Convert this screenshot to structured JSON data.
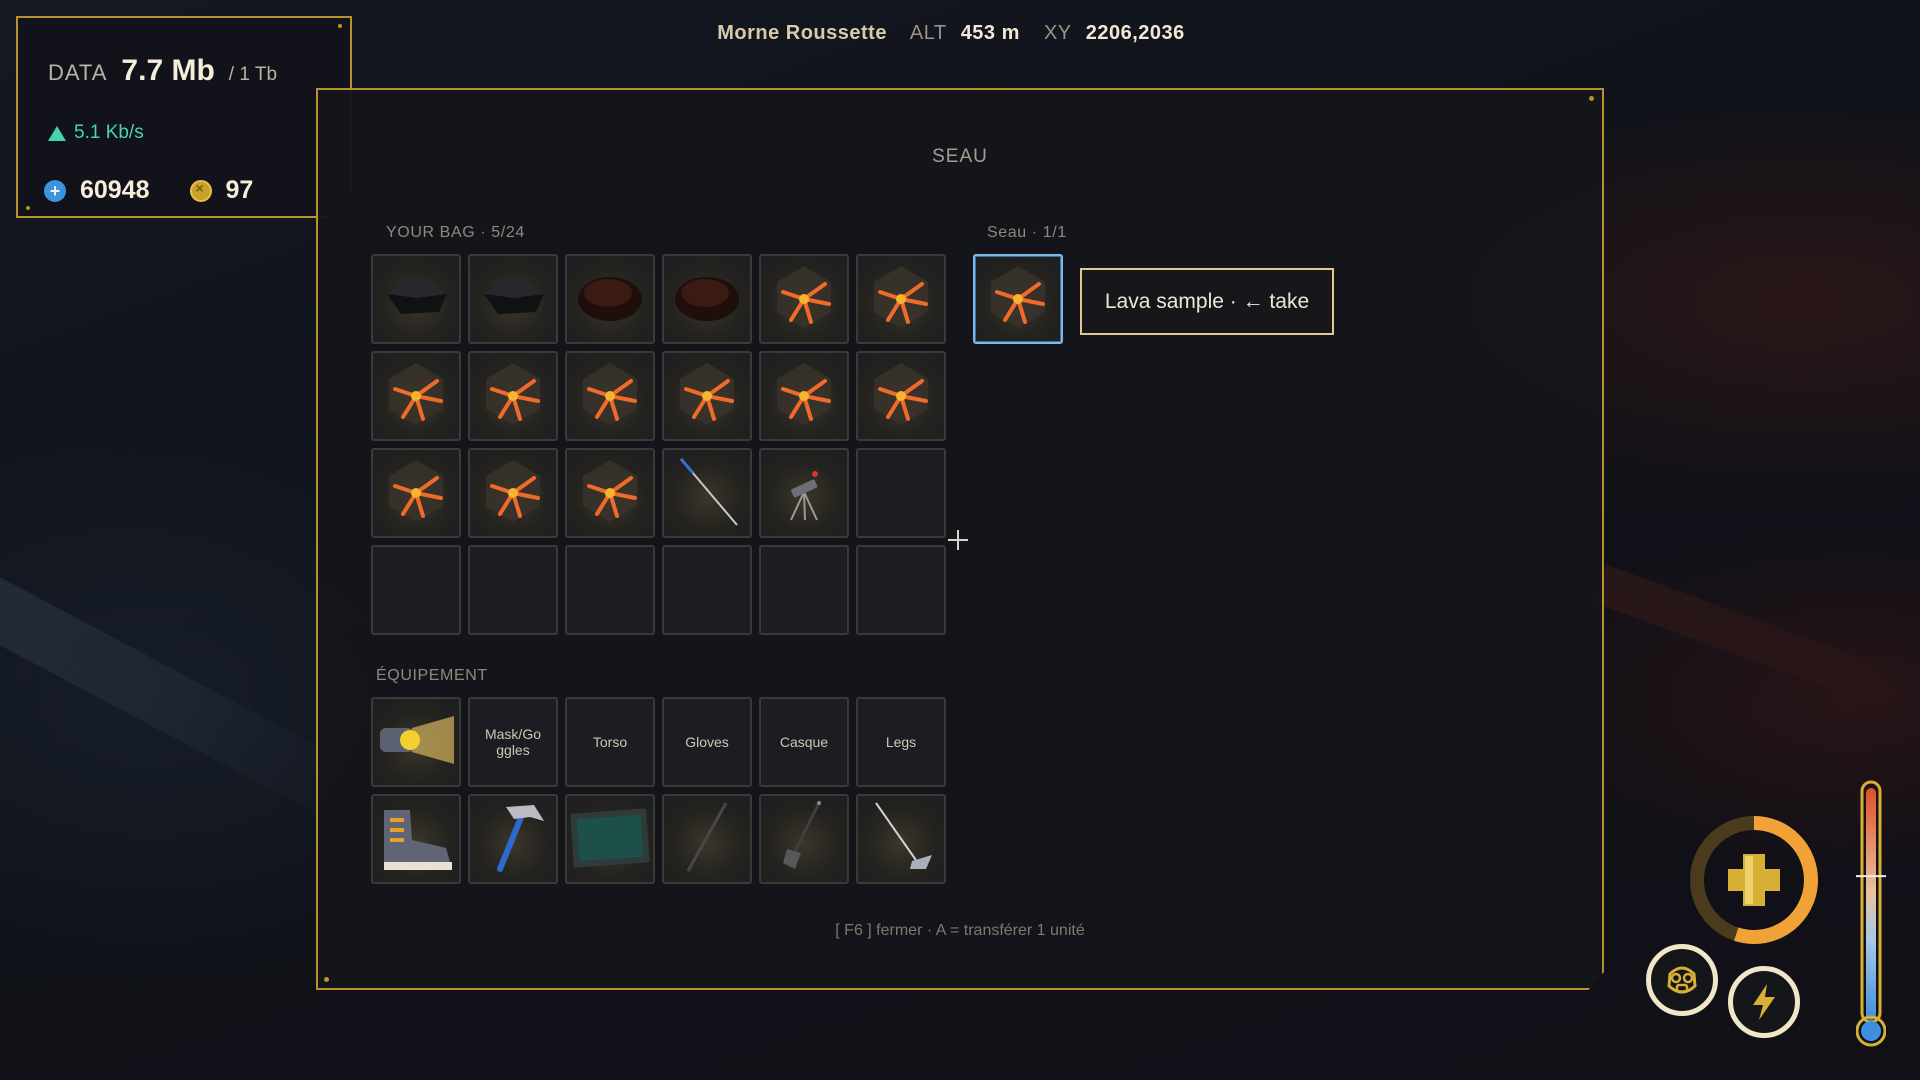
{
  "hud": {
    "location": "Morne Roussette",
    "alt_label": "ALT",
    "alt_value": "453 m",
    "xy_label": "XY",
    "xy_value": "2206,2036"
  },
  "data_panel": {
    "label": "DATA",
    "value": "7.7 Mb",
    "capacity": "/ 1 Tb",
    "rate": "5.1 Kb/s",
    "credits": "60948",
    "coins": "97"
  },
  "container": {
    "title": "SEAU",
    "bag_label": "YOUR BAG  ·  5/24",
    "container_label": "Seau  ·  1/1",
    "equipment_label": "ÉQUIPEMENT",
    "hint": "Lava sample · ← take",
    "footer": "[ F6 ] fermer · A = transférer 1 unité"
  },
  "bag_slots": [
    {
      "item": "dark-rock-icon"
    },
    {
      "item": "dark-rock-icon"
    },
    {
      "item": "red-rock-icon"
    },
    {
      "item": "red-rock-icon"
    },
    {
      "item": "lava-sample-icon"
    },
    {
      "item": "lava-sample-icon"
    },
    {
      "item": "lava-sample-icon"
    },
    {
      "item": "lava-sample-icon"
    },
    {
      "item": "lava-sample-icon"
    },
    {
      "item": "lava-sample-icon"
    },
    {
      "item": "lava-sample-icon"
    },
    {
      "item": "lava-sample-icon"
    },
    {
      "item": "lava-sample-icon"
    },
    {
      "item": "lava-sample-icon"
    },
    {
      "item": "lava-sample-icon"
    },
    {
      "item": "probe-rod-icon"
    },
    {
      "item": "tripod-sensor-icon"
    },
    {
      "item": ""
    },
    {
      "item": ""
    },
    {
      "item": ""
    },
    {
      "item": ""
    },
    {
      "item": ""
    },
    {
      "item": ""
    },
    {
      "item": ""
    }
  ],
  "equipment_slots": [
    {
      "item": "headlamp-icon",
      "label": ""
    },
    {
      "item": "",
      "label": "Mask/Go ggles"
    },
    {
      "item": "",
      "label": "Torso"
    },
    {
      "item": "",
      "label": "Gloves"
    },
    {
      "item": "",
      "label": "Casque"
    },
    {
      "item": "",
      "label": "Legs"
    },
    {
      "item": "boot-icon",
      "label": ""
    },
    {
      "item": "hammer-icon",
      "label": ""
    },
    {
      "item": "tablet-icon",
      "label": ""
    },
    {
      "item": "staff-icon",
      "label": ""
    },
    {
      "item": "shovel-icon",
      "label": ""
    },
    {
      "item": "hoe-icon",
      "label": ""
    }
  ],
  "container_slots": [
    {
      "item": "lava-sample-icon"
    }
  ],
  "status": {
    "health_fraction": 0.55,
    "temperature_fraction": 0.62
  },
  "colors": {
    "accent_gold": "#b8922e",
    "lava_orange": "#f06a2a",
    "selected_blue": "#7fb8e6",
    "rate_green": "#47d3b0"
  }
}
